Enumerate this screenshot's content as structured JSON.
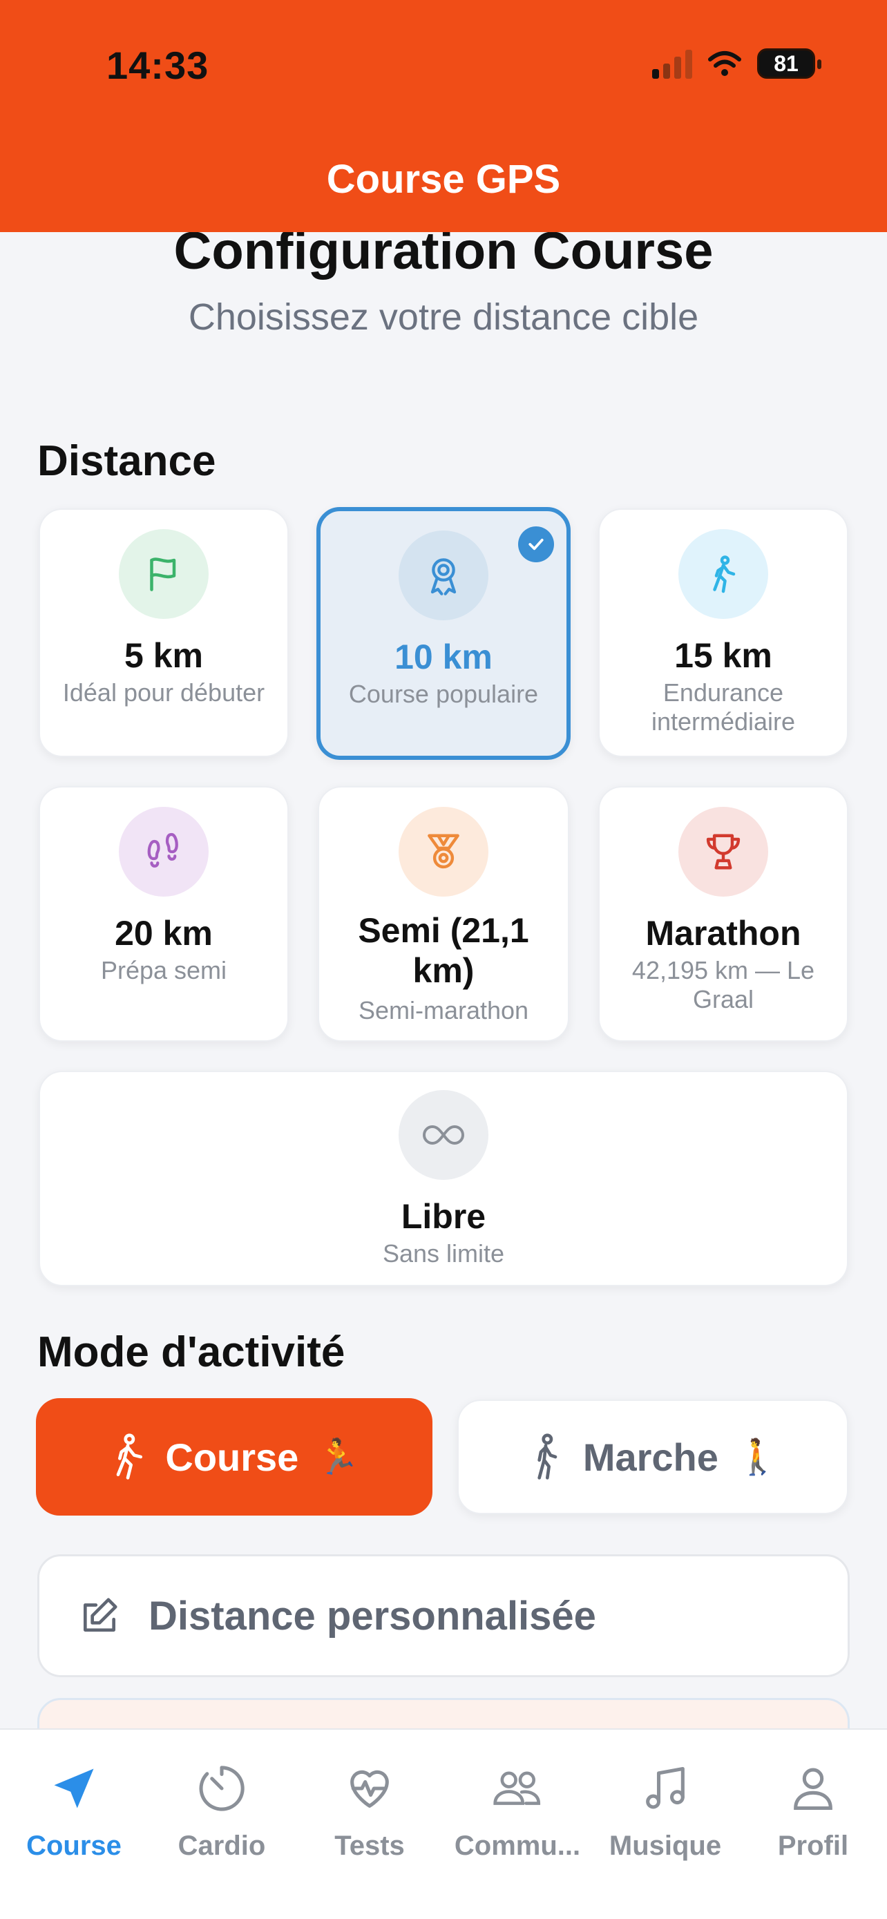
{
  "status_bar": {
    "time": "14:33",
    "battery": "81"
  },
  "nav": {
    "title": "Course GPS"
  },
  "header": {
    "title": "Configuration Course",
    "subtitle": "Choisissez votre distance cible"
  },
  "distance_section": {
    "title": "Distance",
    "options": [
      {
        "title": "5 km",
        "desc": "Idéal pour débuter",
        "icon": "flag-icon",
        "selected": false
      },
      {
        "title": "10 km",
        "desc": "Course populaire",
        "icon": "medal-icon",
        "selected": true
      },
      {
        "title": "15 km",
        "desc": "Endurance intermédiaire",
        "icon": "walker-icon",
        "selected": false
      },
      {
        "title": "20 km",
        "desc": "Prépa semi",
        "icon": "footprints-icon",
        "selected": false
      },
      {
        "title": "Semi (21,1 km)",
        "desc": "Semi-marathon",
        "icon": "medal-ribbon-icon",
        "selected": false
      },
      {
        "title": "Marathon",
        "desc": "42,195 km — Le Graal",
        "icon": "trophy-icon",
        "selected": false
      },
      {
        "title": "Libre",
        "desc": "Sans limite",
        "icon": "infinity-icon",
        "selected": false
      }
    ]
  },
  "mode_section": {
    "title": "Mode d'activité",
    "run_label": "Course",
    "run_emoji": "🏃",
    "walk_label": "Marche",
    "walk_emoji": "🚶",
    "selected": "Course"
  },
  "custom_distance": {
    "label": "Distance personnalisée"
  },
  "tabs": [
    {
      "label": "Course",
      "icon": "navigation-arrow-icon",
      "active": true
    },
    {
      "label": "Cardio",
      "icon": "timer-icon",
      "active": false
    },
    {
      "label": "Tests",
      "icon": "heart-pulse-icon",
      "active": false
    },
    {
      "label": "Commu...",
      "icon": "community-icon",
      "active": false
    },
    {
      "label": "Musique",
      "icon": "music-note-icon",
      "active": false
    },
    {
      "label": "Profil",
      "icon": "profile-icon",
      "active": false
    }
  ],
  "colors": {
    "accent": "#f04d17",
    "selected_blue": "#3a8fd4",
    "tab_active": "#2b8ee8",
    "icon_green_bg": "#e3f4e9",
    "icon_blue_bg": "#dcebf6",
    "icon_cyan_bg": "#e0f3fc",
    "icon_purple_bg": "#f1e4f6",
    "icon_orange_bg": "#fdeadc",
    "icon_red_bg": "#f9e2e0",
    "icon_gray_bg": "#eceef1"
  }
}
